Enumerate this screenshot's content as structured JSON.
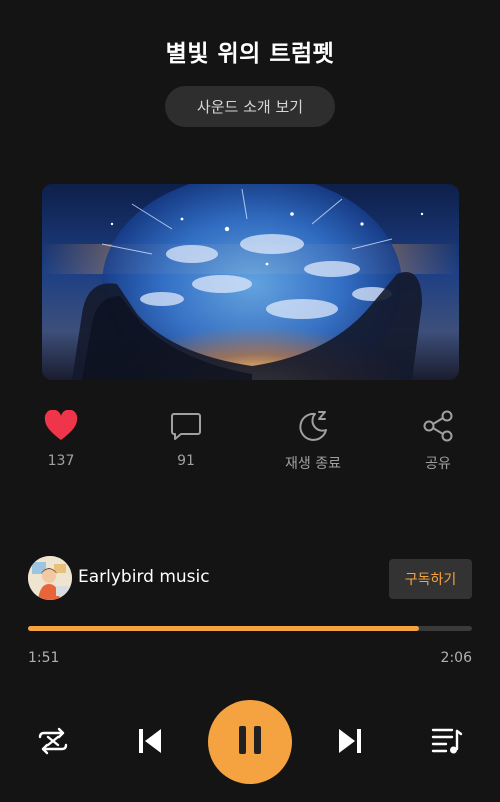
{
  "track": {
    "title": "별빛 위의 트럼펫",
    "intro_button": "사운드 소개 보기"
  },
  "actions": [
    {
      "icon": "heart-icon",
      "label": "137",
      "color": "#f0354a"
    },
    {
      "icon": "comment-icon",
      "label": "91"
    },
    {
      "icon": "sleep-timer-icon",
      "label": "재생 종료"
    },
    {
      "icon": "share-icon",
      "label": "공유"
    }
  ],
  "artist": {
    "name": "Earlybird music",
    "subscribe_label": "구독하기"
  },
  "playback": {
    "current_time": "1:51",
    "total_time": "2:06",
    "progress": 0.881,
    "state": "playing"
  },
  "controls": {
    "repeat": "repeat-icon",
    "previous": "skip-previous-icon",
    "play_pause": "pause-icon",
    "next": "skip-next-icon",
    "queue": "playlist-icon"
  },
  "colors": {
    "accent": "#f5a340",
    "background": "#141414",
    "like": "#f0354a"
  }
}
